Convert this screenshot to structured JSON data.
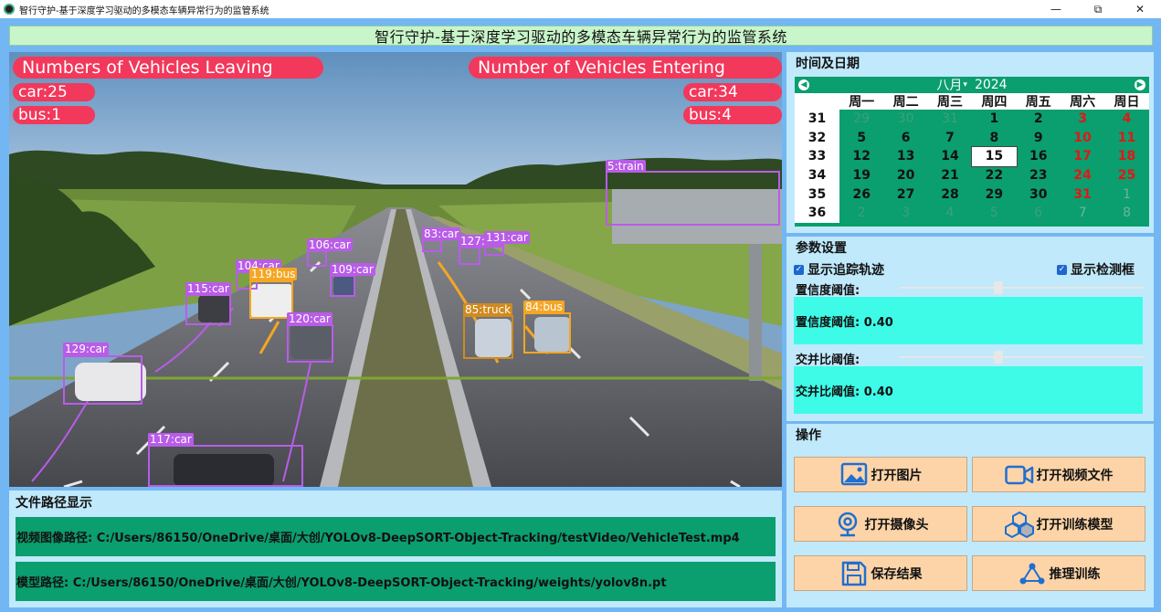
{
  "window": {
    "title": "智行守护-基于深度学习驱动的多模态车辆异常行为的监管系统",
    "min_icon": "minimize-icon",
    "max_icon": "restore-icon",
    "close_icon": "close-icon",
    "min_glyph": "—",
    "max_glyph": "⧉",
    "close_glyph": "✕"
  },
  "banner": "智行守护-基于深度学习驱动的多模态车辆异常行为的监管系统",
  "video": {
    "leaving_title": "Numbers of Vehicles Leaving",
    "leaving_car": "car:25",
    "leaving_bus": "bus:1",
    "entering_title": "Number of Vehicles Entering",
    "entering_car": "car:34",
    "entering_bus": "bus:4",
    "detections": [
      {
        "label": "5:train",
        "color": "#b95ce8"
      },
      {
        "label": "83:car",
        "color": "#b95ce8"
      },
      {
        "label": "127:car",
        "color": "#b95ce8"
      },
      {
        "label": "131:car",
        "color": "#b95ce8"
      },
      {
        "label": "106:car",
        "color": "#b95ce8"
      },
      {
        "label": "104:car",
        "color": "#b95ce8"
      },
      {
        "label": "119:bus",
        "color": "#f5a623"
      },
      {
        "label": "109:car",
        "color": "#b95ce8"
      },
      {
        "label": "115:car",
        "color": "#b95ce8"
      },
      {
        "label": "85:truck",
        "color": "#d08a1e"
      },
      {
        "label": "84:bus",
        "color": "#f5a623"
      },
      {
        "label": "120:car",
        "color": "#b95ce8"
      },
      {
        "label": "129:car",
        "color": "#b95ce8"
      },
      {
        "label": "117:car",
        "color": "#b95ce8"
      }
    ]
  },
  "path_panel": {
    "heading": "文件路径显示",
    "video_path": "视频图像路径: C:/Users/86150/OneDrive/桌面/大创/YOLOv8-DeepSORT-Object-Tracking/testVideo/VehicleTest.mp4",
    "model_path": "模型路径: C:/Users/86150/OneDrive/桌面/大创/YOLOv8-DeepSORT-Object-Tracking/weights/yolov8n.pt"
  },
  "calendar": {
    "heading": "时间及日期",
    "month_label": "八月",
    "year_label": "2024",
    "prev_icon": "prev-month-icon",
    "next_icon": "next-month-icon",
    "weekdays": [
      "周一",
      "周二",
      "周三",
      "周四",
      "周五",
      "周六",
      "周日"
    ],
    "weeks": [
      {
        "wk": "31",
        "days": [
          "29",
          "30",
          "31",
          "1",
          "2",
          "3",
          "4"
        ]
      },
      {
        "wk": "32",
        "days": [
          "5",
          "6",
          "7",
          "8",
          "9",
          "10",
          "11"
        ]
      },
      {
        "wk": "33",
        "days": [
          "12",
          "13",
          "14",
          "15",
          "16",
          "17",
          "18"
        ]
      },
      {
        "wk": "34",
        "days": [
          "19",
          "20",
          "21",
          "22",
          "23",
          "24",
          "25"
        ]
      },
      {
        "wk": "35",
        "days": [
          "26",
          "27",
          "28",
          "29",
          "30",
          "31",
          "1"
        ]
      },
      {
        "wk": "36",
        "days": [
          "2",
          "3",
          "4",
          "5",
          "6",
          "7",
          "8"
        ]
      }
    ],
    "selected": "15"
  },
  "params": {
    "heading": "参数设置",
    "show_track": "显示追踪轨迹",
    "show_box": "显示检测框",
    "conf_label": "置信度阈值:",
    "conf_value_text": "置信度阈值: 0.40",
    "conf_value": 0.4,
    "iou_label": "交并比阈值:",
    "iou_value_text": "交并比阈值: 0.40",
    "iou_value": 0.4
  },
  "ops": {
    "heading": "操作",
    "open_image": "打开图片",
    "open_video": "打开视频文件",
    "open_camera": "打开摄像头",
    "open_model": "打开训练模型",
    "save_result": "保存结果",
    "train": "推理训练"
  },
  "colors": {
    "background": "#72b7f3",
    "panel": "#c0e9fb",
    "green": "#0b9e6e",
    "cyan": "#3efbe7",
    "button": "#fdd4a8",
    "hud": "#f2385b"
  }
}
